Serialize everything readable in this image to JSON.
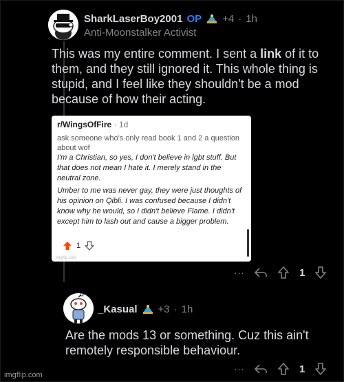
{
  "comment1": {
    "username": "SharkLaserBoy2001",
    "op_badge": "OP",
    "award_count": "+4",
    "separator": "·",
    "time": "1h",
    "flair": "Anti-Moonstalker Activist",
    "body_before": "This was my entire comment. I sent a ",
    "body_link": "link",
    "body_after": " of it to them, and they still ignored it. This whole thing is stupid, and I feel like they shouldn't be a mod because of how their acting.",
    "vote_count": "1",
    "more_label": "···"
  },
  "embed": {
    "subreddit": "r/WingsOfFire",
    "separator": "·",
    "time": "1d",
    "question": "ask someone who's only read book 1 and 2 a question about wof",
    "para1": "I'm a Christian, so yes, I don't believe in lgbt stuff. But that does not mean I hate it. I merely stand in the neutral zone.",
    "para2": "Umber to me was never gay, they were just thoughts of his opinion on Qibli. I was confused because I didn't know why he would, so I didn't believe Flame. I didn't except him to lash out and cause a bigger problem.",
    "vote_count": "1",
    "watermark": "imgflip.com"
  },
  "comment2": {
    "username": "_Kasual",
    "award_count": "+3",
    "separator": "·",
    "time": "1h",
    "body": "Are the mods 13 or something. Cuz this ain't remotely responsible behaviour.",
    "vote_count": "1",
    "more_label": "···"
  },
  "watermark": "imgflip.com",
  "colors": {
    "op": "#2d7ff9",
    "upvote": "#ff4500",
    "background": "#000000"
  }
}
